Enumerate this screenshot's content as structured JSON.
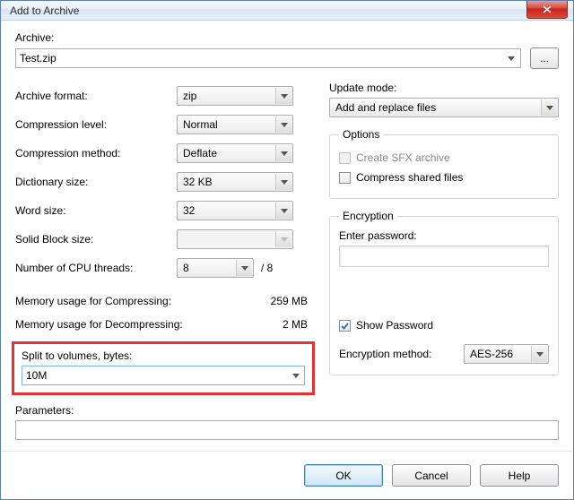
{
  "window": {
    "title": "Add to Archive"
  },
  "archive": {
    "label": "Archive:",
    "value": "Test.zip",
    "browse": "..."
  },
  "left": {
    "format": {
      "label": "Archive format:",
      "value": "zip"
    },
    "level": {
      "label": "Compression level:",
      "value": "Normal"
    },
    "method": {
      "label": "Compression method:",
      "value": "Deflate"
    },
    "dict": {
      "label": "Dictionary size:",
      "value": "32 KB"
    },
    "word": {
      "label": "Word size:",
      "value": "32"
    },
    "block": {
      "label": "Solid Block size:",
      "value": ""
    },
    "threads": {
      "label": "Number of CPU threads:",
      "value": "8",
      "of": "/ 8"
    },
    "mem_comp": {
      "label": "Memory usage for Compressing:",
      "value": "259 MB"
    },
    "mem_dec": {
      "label": "Memory usage for Decompressing:",
      "value": "2 MB"
    },
    "split": {
      "label": "Split to volumes, bytes:",
      "value": "10M"
    }
  },
  "right": {
    "update": {
      "label": "Update mode:",
      "value": "Add and replace files"
    },
    "options": {
      "legend": "Options",
      "sfx": {
        "label": "Create SFX archive",
        "checked": false,
        "disabled": true
      },
      "shared": {
        "label": "Compress shared files",
        "checked": false,
        "disabled": false
      }
    },
    "encryption": {
      "legend": "Encryption",
      "pw_label": "Enter password:",
      "pw_value": "",
      "show_pw": {
        "label": "Show Password",
        "checked": true
      },
      "method": {
        "label": "Encryption method:",
        "value": "AES-256"
      }
    }
  },
  "params": {
    "label": "Parameters:",
    "value": ""
  },
  "buttons": {
    "ok": "OK",
    "cancel": "Cancel",
    "help": "Help"
  }
}
